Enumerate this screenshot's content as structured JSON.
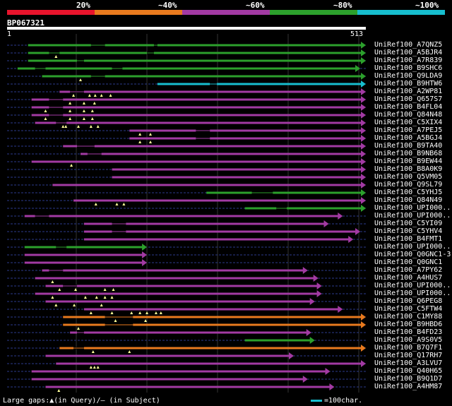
{
  "legend": {
    "segments": [
      {
        "label": "20%",
        "color": "#e8142c"
      },
      {
        "label": "~40%",
        "color": "#e87a1e"
      },
      {
        "label": "~60%",
        "color": "#a23aa3"
      },
      {
        "label": "~80%",
        "color": "#2ca02c"
      },
      {
        "label": "~100%",
        "color": "#17becf"
      }
    ]
  },
  "query": {
    "id": "BP067321",
    "start": "1",
    "end": "513",
    "length": 513
  },
  "colors": {
    "green": "#2ca02c",
    "purple": "#a23aa3",
    "cyan": "#17becf",
    "orange": "#e87a1e",
    "gap": "#2b3a8c",
    "marker": "#ffff99"
  },
  "hits": [
    {
      "name": "UniRef100_A7QNZ5",
      "color": "green",
      "start": 30,
      "end": 513,
      "gaps": [
        [
          120,
          140
        ],
        [
          210,
          215
        ]
      ],
      "markers": []
    },
    {
      "name": "UniRef100_A5BJR4",
      "color": "green",
      "start": 30,
      "end": 513,
      "gaps": [
        [
          60,
          75
        ],
        [
          200,
          210
        ]
      ],
      "markers": [
        70
      ]
    },
    {
      "name": "UniRef100_A7R839",
      "color": "green",
      "start": 30,
      "end": 513,
      "gaps": [
        [
          100,
          110
        ]
      ],
      "markers": []
    },
    {
      "name": "UniRef100_B9SHC6",
      "color": "green",
      "start": 15,
      "end": 505,
      "gaps": [
        [
          40,
          55
        ],
        [
          150,
          165
        ]
      ],
      "markers": []
    },
    {
      "name": "UniRef100_Q9LDA9",
      "color": "green",
      "start": 50,
      "end": 513,
      "gaps": [
        [
          120,
          140
        ]
      ],
      "markers": [
        105
      ]
    },
    {
      "name": "UniRef100_B9HTW6",
      "color": "cyan",
      "start": 215,
      "end": 513,
      "gaps": [
        [
          290,
          300
        ]
      ],
      "markers": []
    },
    {
      "name": "UniRef100_A2WP81",
      "color": "purple",
      "start": 75,
      "end": 513,
      "gaps": [
        [
          90,
          110
        ]
      ],
      "markers": [
        95,
        118,
        126,
        135,
        148
      ]
    },
    {
      "name": "UniRef100_Q657S7",
      "color": "purple",
      "start": 35,
      "end": 513,
      "gaps": [
        [
          60,
          80
        ]
      ],
      "markers": [
        90,
        110,
        125
      ]
    },
    {
      "name": "UniRef100_B4FL04",
      "color": "purple",
      "start": 35,
      "end": 513,
      "gaps": [
        [
          60,
          80
        ]
      ],
      "markers": [
        55,
        90,
        110,
        122
      ]
    },
    {
      "name": "UniRef100_Q84N48",
      "color": "purple",
      "start": 35,
      "end": 513,
      "gaps": [
        [
          60,
          80
        ]
      ],
      "markers": [
        55,
        90,
        110,
        122
      ]
    },
    {
      "name": "UniRef100_C5XIX4",
      "color": "purple",
      "start": 40,
      "end": 513,
      "gaps": [
        [
          70,
          85
        ]
      ],
      "markers": [
        80,
        84,
        102,
        120,
        130
      ]
    },
    {
      "name": "UniRef100_A7PEJ5",
      "color": "purple",
      "start": 175,
      "end": 513,
      "gaps": [
        [
          270,
          290
        ]
      ],
      "markers": [
        190,
        205
      ]
    },
    {
      "name": "UniRef100_A5BGJ4",
      "color": "purple",
      "start": 175,
      "end": 513,
      "gaps": [
        [
          270,
          290
        ]
      ],
      "markers": [
        190,
        205
      ]
    },
    {
      "name": "UniRef100_B9TA40",
      "color": "purple",
      "start": 80,
      "end": 513,
      "gaps": [
        [
          100,
          125
        ]
      ],
      "markers": []
    },
    {
      "name": "UniRef100_B9NB68",
      "color": "purple",
      "start": 105,
      "end": 513,
      "gaps": [
        [
          115,
          135
        ]
      ],
      "markers": []
    },
    {
      "name": "UniRef100_B9EW44",
      "color": "purple",
      "start": 35,
      "end": 513,
      "gaps": [],
      "markers": [
        92
      ]
    },
    {
      "name": "UniRef100_B8A0K9",
      "color": "purple",
      "start": 150,
      "end": 513,
      "gaps": [],
      "markers": []
    },
    {
      "name": "UniRef100_Q5VM05",
      "color": "purple",
      "start": 150,
      "end": 513,
      "gaps": [],
      "markers": []
    },
    {
      "name": "UniRef100_Q9SL79",
      "color": "purple",
      "start": 65,
      "end": 513,
      "gaps": [],
      "markers": []
    },
    {
      "name": "UniRef100_C5YHJ5",
      "color": "green",
      "start": 285,
      "end": 513,
      "gaps": [
        [
          350,
          380
        ]
      ],
      "markers": []
    },
    {
      "name": "UniRef100_Q84N49",
      "color": "purple",
      "start": 95,
      "end": 513,
      "gaps": [],
      "markers": [
        127,
        157,
        167
      ]
    },
    {
      "name": "UniRef100_UPI000...",
      "color": "green",
      "start": 340,
      "end": 513,
      "gaps": [
        [
          385,
          400
        ]
      ],
      "markers": []
    },
    {
      "name": "UniRef100_UPI000...",
      "color": "purple",
      "start": 25,
      "end": 480,
      "gaps": [
        [
          40,
          60
        ]
      ],
      "markers": []
    },
    {
      "name": "UniRef100_C5YI09",
      "color": "purple",
      "start": 110,
      "end": 460,
      "gaps": [
        [
          150,
          170
        ]
      ],
      "markers": []
    },
    {
      "name": "UniRef100_C5YHV4",
      "color": "purple",
      "start": 110,
      "end": 505,
      "gaps": [
        [
          150,
          170
        ]
      ],
      "markers": []
    },
    {
      "name": "UniRef100_B4FMT1",
      "color": "purple",
      "start": 110,
      "end": 495,
      "gaps": [],
      "markers": []
    },
    {
      "name": "UniRef100_UPI000...",
      "color": "green",
      "start": 25,
      "end": 200,
      "gaps": [
        [
          70,
          85
        ]
      ],
      "markers": []
    },
    {
      "name": "UniRef100_Q0GNC1-3",
      "color": "purple",
      "start": 25,
      "end": 200,
      "gaps": [],
      "markers": []
    },
    {
      "name": "UniRef100_Q0GNC1",
      "color": "purple",
      "start": 25,
      "end": 200,
      "gaps": [],
      "markers": []
    },
    {
      "name": "UniRef100_A7PY62",
      "color": "purple",
      "start": 50,
      "end": 430,
      "gaps": [
        [
          60,
          80
        ]
      ],
      "markers": []
    },
    {
      "name": "UniRef100_A4HUS7",
      "color": "purple",
      "start": 40,
      "end": 445,
      "gaps": [],
      "markers": [
        65
      ]
    },
    {
      "name": "UniRef100_UPI000...",
      "color": "purple",
      "start": 55,
      "end": 450,
      "gaps": [
        [
          80,
          100
        ]
      ],
      "markers": [
        75,
        98,
        140,
        152
      ]
    },
    {
      "name": "UniRef100_UPI000...",
      "color": "purple",
      "start": 40,
      "end": 450,
      "gaps": [],
      "markers": [
        65,
        112,
        128,
        140,
        150
      ]
    },
    {
      "name": "UniRef100_Q6PEG8",
      "color": "purple",
      "start": 55,
      "end": 440,
      "gaps": [],
      "markers": [
        70,
        96,
        135
      ]
    },
    {
      "name": "UniRef100_C5FTW4",
      "color": "purple",
      "start": 110,
      "end": 480,
      "gaps": [],
      "markers": [
        120,
        150,
        178,
        190,
        200,
        213,
        220
      ]
    },
    {
      "name": "UniRef100_C1MY88",
      "color": "orange",
      "start": 80,
      "end": 513,
      "gaps": [
        [
          140,
          180
        ]
      ],
      "markers": [
        155,
        198
      ]
    },
    {
      "name": "UniRef100_B9HBD6",
      "color": "orange",
      "start": 80,
      "end": 513,
      "gaps": [
        [
          140,
          180
        ]
      ],
      "markers": [
        102
      ]
    },
    {
      "name": "UniRef100_B4FD23",
      "color": "purple",
      "start": 90,
      "end": 435,
      "gaps": [
        [
          100,
          110
        ]
      ],
      "markers": []
    },
    {
      "name": "UniRef100_A9S0V5",
      "color": "green",
      "start": 340,
      "end": 440,
      "gaps": [],
      "markers": []
    },
    {
      "name": "UniRef100_B7Q7F1",
      "color": "orange",
      "start": 75,
      "end": 513,
      "gaps": [
        [
          95,
          110
        ]
      ],
      "markers": [
        123,
        175
      ]
    },
    {
      "name": "UniRef100_Q17RH7",
      "color": "purple",
      "start": 55,
      "end": 410,
      "gaps": [],
      "markers": []
    },
    {
      "name": "UniRef100_A3LVU7",
      "color": "purple",
      "start": 70,
      "end": 513,
      "gaps": [],
      "markers": [
        120,
        125,
        130
      ]
    },
    {
      "name": "UniRef100_Q40H65",
      "color": "purple",
      "start": 35,
      "end": 462,
      "gaps": [],
      "markers": []
    },
    {
      "name": "UniRef100_B9Q1D7",
      "color": "purple",
      "start": 35,
      "end": 430,
      "gaps": [],
      "markers": []
    },
    {
      "name": "UniRef100_A4HM87",
      "color": "purple",
      "start": 55,
      "end": 468,
      "gaps": [],
      "markers": [
        74
      ]
    }
  ],
  "footer": {
    "text": "Large gaps:▲(in Query)/— (in Subject)",
    "scale_label": "=100char."
  }
}
